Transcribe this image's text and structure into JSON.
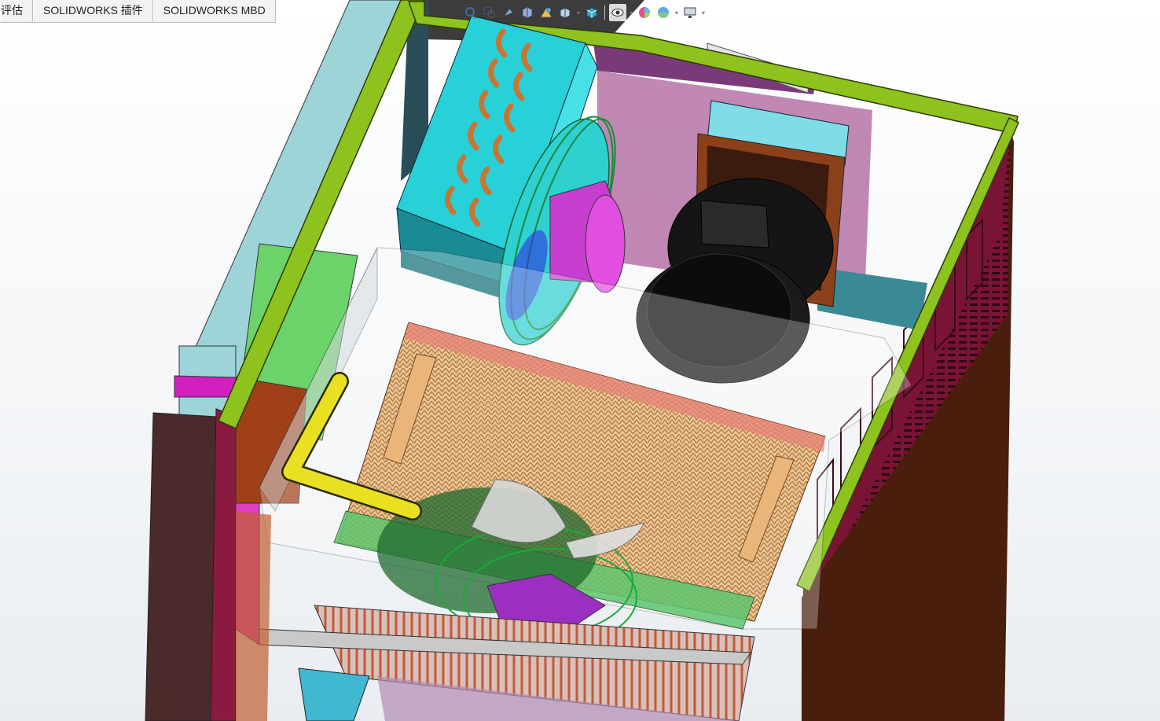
{
  "tabs": [
    {
      "label": "评估"
    },
    {
      "label": "SOLIDWORKS 插件"
    },
    {
      "label": "SOLIDWORKS MBD"
    }
  ],
  "heads_up_toolbar": {
    "items": [
      {
        "icon": "zoom-to-fit-icon"
      },
      {
        "icon": "zoom-to-area-icon"
      },
      {
        "icon": "previous-view-icon"
      },
      {
        "icon": "section-view-icon"
      },
      {
        "icon": "dynamic-annotation-views-icon"
      },
      {
        "icon": "view-orientation-icon"
      },
      {
        "icon": "display-style-icon"
      },
      {
        "icon": "hide-show-items-icon"
      },
      {
        "icon": "edit-appearance-icon"
      },
      {
        "icon": "apply-scene-icon"
      },
      {
        "icon": "view-settings-icon"
      }
    ]
  },
  "colors": {
    "frame_green": "#8dc21f",
    "condenser_cyan": "#3fd0d0",
    "copper": "#c87533",
    "magenta_bracket": "#d24ad2",
    "panel_maroon": "#7a1434",
    "compressor_black": "#151515",
    "handle_yellow": "#e8e020"
  }
}
